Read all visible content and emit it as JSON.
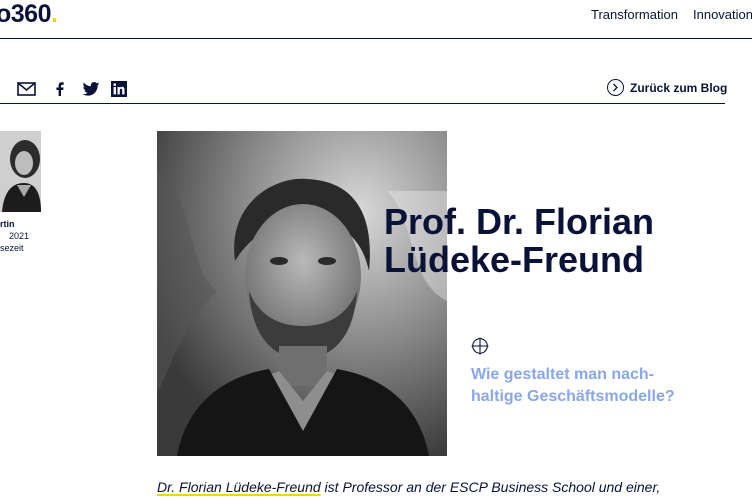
{
  "header": {
    "logo_main": "o360",
    "logo_dot": ".",
    "nav": [
      "Transformation",
      "Innovation"
    ]
  },
  "share": {
    "icons": [
      "mail-icon",
      "facebook-icon",
      "twitter-icon",
      "linkedin-icon"
    ],
    "back_label": "Zurück zum Blog"
  },
  "author": {
    "name_fragment": "rtin",
    "date_fragment": "2021",
    "readtime_fragment": "sezeit"
  },
  "hero": {
    "title_line1": "Prof. Dr. Florian",
    "title_line2": "Lüdeke-Freund",
    "subtitle_line1": "Wie gestaltet man nach-",
    "subtitle_line2": "haltige Geschäftsmodelle?"
  },
  "intro": {
    "highlight": "Dr. Florian Lüdeke-Freund",
    "rest": " ist Professor an der ESCP Business School und einer,"
  },
  "colors": {
    "navy": "#0b1238",
    "accent_yellow": "#f2d600",
    "subtitle_blue": "#8aa7ea"
  }
}
